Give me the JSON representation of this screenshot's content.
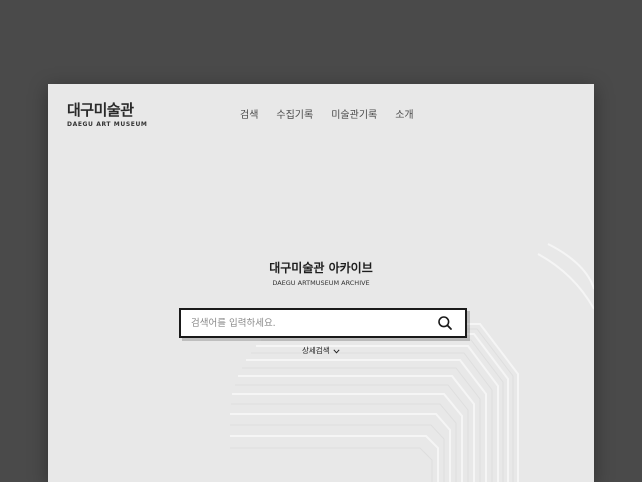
{
  "logo": {
    "name_ko": "대구미술관",
    "name_en": "DAEGU ART MUSEUM"
  },
  "nav": {
    "items": [
      {
        "label": "검색"
      },
      {
        "label": "수집기록"
      },
      {
        "label": "미술관기록"
      },
      {
        "label": "소개"
      }
    ]
  },
  "hero": {
    "title": "대구미술관 아카이브",
    "subtitle": "DAEGU ARTMUSEUM ARCHIVE"
  },
  "search": {
    "placeholder": "검색어를 입력하세요.",
    "value": ""
  },
  "advanced_search": {
    "label": "상세검색"
  },
  "icons": {
    "search": "search-icon",
    "chevron": "chevron-down-icon"
  },
  "colors": {
    "page_background": "#4a4a4a",
    "frame_background": "#e8e8e8",
    "search_border": "#1a1a1a"
  }
}
